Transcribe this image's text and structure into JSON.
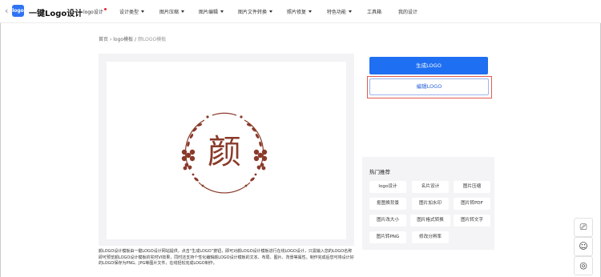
{
  "nav": {
    "back": "‹",
    "logo_mark": "logo",
    "brand": "一键Logo设计",
    "items": [
      {
        "label": "logo设计",
        "dot": true
      },
      {
        "label": "设计类型",
        "caret": true
      },
      {
        "label": "图片压缩",
        "caret": true
      },
      {
        "label": "图片编辑",
        "caret": true
      },
      {
        "label": "图片文件转换",
        "caret": true
      },
      {
        "label": "照片修复",
        "caret": true
      },
      {
        "label": "特色功能",
        "caret": true
      },
      {
        "label": "工具箱"
      },
      {
        "label": "我的设计"
      }
    ]
  },
  "breadcrumb": {
    "home": "首页",
    "sep1": "›",
    "section": "logo模板",
    "sep2": "/",
    "current": "颜LOGO模板"
  },
  "preview": {
    "glyph": "颜",
    "accent_color": "#8a3a2a"
  },
  "description": "颜LOGO设计模板由一键LOGO设计网站提供，点击“生成LOGO”按钮，即可对颜LOGO设计模板进行在线LOGO设计，只需输入您的LOGO名称即可预览颜LOGO设计模板的实时VI效果，同时还支持个性化编辑颜LOGO设计模板的文本、布局、图片、背景等属性。制作完成后您可将设计好的LOGO保存为PNG、JPG等图片文件，在线轻松完成LOGO制作。",
  "actions": {
    "generate": "生成LOGO",
    "edit": "编辑LOGO"
  },
  "hot": {
    "title": "热门推荐",
    "tags": [
      "logo设计",
      "名片设计",
      "图片压缩",
      "抠图换背景",
      "图片加水印",
      "图片转PDF",
      "图片改大小",
      "图片格式转换",
      "图片转文字",
      "图片转PNG",
      "修改分辨率"
    ]
  },
  "float_tools": [
    {
      "name": "feedback-icon",
      "glyph": "⎚"
    },
    {
      "name": "smile-icon",
      "glyph": "☺"
    },
    {
      "name": "support-icon",
      "glyph": "◎"
    }
  ],
  "colors": {
    "primary": "#1f6ff2",
    "highlight": "#e45b4f",
    "logo": "#8a3a2a"
  }
}
